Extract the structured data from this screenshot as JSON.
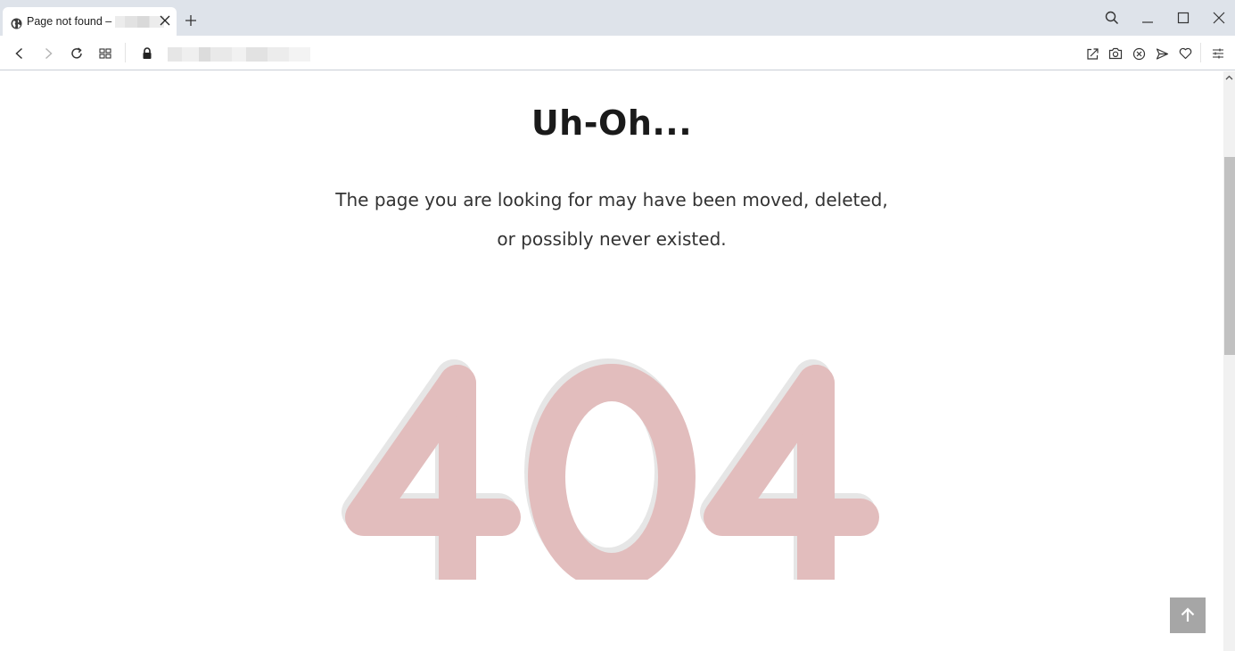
{
  "browser": {
    "tab": {
      "title": "Page not found –",
      "favicon": "globe-icon"
    },
    "toolbar_icons": [
      "back-icon",
      "forward-icon",
      "reload-icon",
      "grid-icon",
      "lock-icon",
      "share-icon",
      "camera-icon",
      "shield-icon",
      "send-icon",
      "heart-icon",
      "menu-icon"
    ],
    "window_icons": [
      "search-icon",
      "minimize-icon",
      "maximize-icon",
      "close-icon"
    ]
  },
  "page": {
    "heading": "Uh-Oh...",
    "message_line1": "The page you are looking for may have been moved, deleted,",
    "message_line2": "or possibly never existed.",
    "error_code": "404",
    "error_color": "#e2bdbd",
    "shadow_color": "#e6e6e6"
  },
  "scroll_top_icon": "arrow-up-icon"
}
